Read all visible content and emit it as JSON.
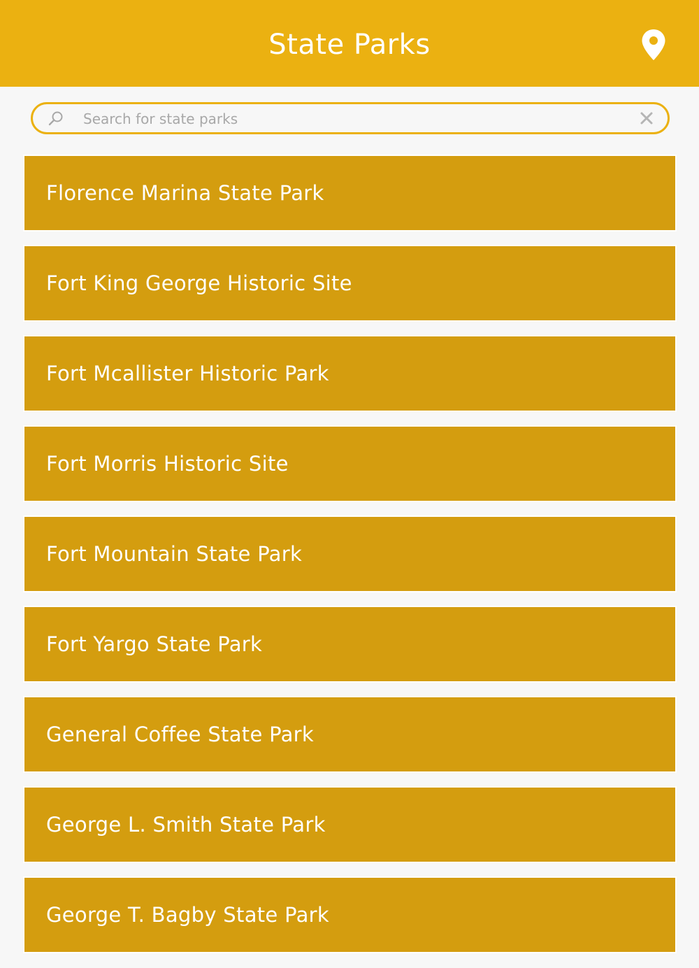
{
  "header": {
    "title": "State Parks",
    "map_icon": "map-pin-icon"
  },
  "search": {
    "placeholder": "Search for state parks",
    "value": "",
    "search_icon": "magnifier-icon",
    "clear_icon": "close-icon"
  },
  "parks": [
    {
      "name": "Florence Marina State Park"
    },
    {
      "name": "Fort King George Historic Site"
    },
    {
      "name": "Fort Mcallister Historic Park"
    },
    {
      "name": "Fort Morris Historic Site"
    },
    {
      "name": "Fort Mountain State Park"
    },
    {
      "name": "Fort Yargo State Park"
    },
    {
      "name": "General Coffee State Park"
    },
    {
      "name": "George L. Smith State Park"
    },
    {
      "name": "George T. Bagby State Park"
    }
  ],
  "colors": {
    "header": "#ebb111",
    "list_item": "#d49d0f",
    "background": "#f7f7f7",
    "text": "#ffffff"
  }
}
